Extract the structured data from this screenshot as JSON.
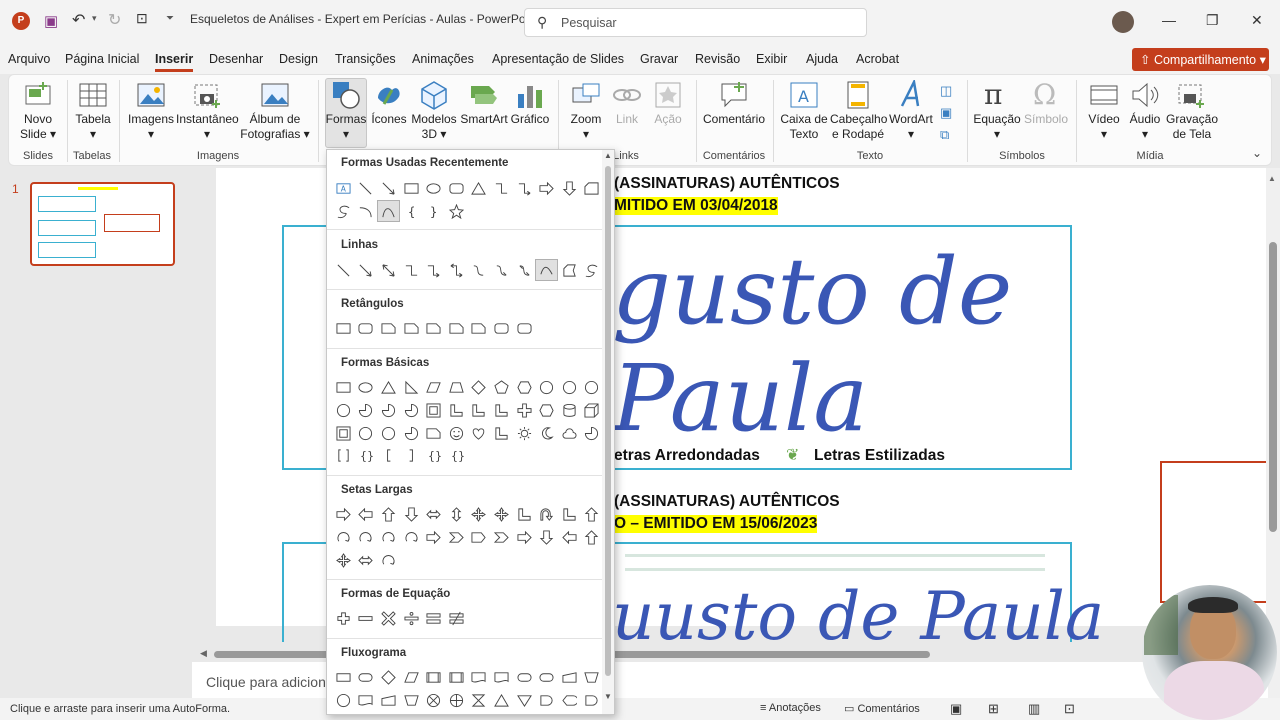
{
  "titlebar": {
    "doc_title": "Esqueletos de Análises - Expert em Perícias - Aulas  -  PowerPoint",
    "search_placeholder": "Pesquisar"
  },
  "menu": {
    "items": [
      "Arquivo",
      "Página Inicial",
      "Inserir",
      "Desenhar",
      "Design",
      "Transições",
      "Animações",
      "Apresentação de Slides",
      "Gravar",
      "Revisão",
      "Exibir",
      "Ajuda",
      "Acrobat"
    ],
    "active": "Inserir",
    "share_label": "Compartilhamento"
  },
  "ribbon": {
    "novo_slide": "Novo Slide",
    "tabela": "Tabela",
    "imagens": "Imagens",
    "instantaneo": "Instantâneo",
    "album": "Álbum de Fotografias",
    "formas": "Formas",
    "icones": "Ícones",
    "modelos3d": "Modelos 3D",
    "smartart": "SmartArt",
    "grafico": "Gráfico",
    "zoom": "Zoom",
    "link": "Link",
    "acao": "Ação",
    "comentario": "Comentário",
    "caixa_texto": "Caixa de Texto",
    "cabecalho": "Cabeçalho e Rodapé",
    "wordart": "WordArt",
    "equacao": "Equação",
    "simbolo": "Símbolo",
    "video": "Vídeo",
    "audio": "Áudio",
    "gravacao": "Gravação de Tela",
    "groups": {
      "slides": "Slides",
      "tabelas": "Tabelas",
      "imagens": "Imagens",
      "links": "Links",
      "comentarios": "Comentários",
      "texto": "Texto",
      "simbolos": "Símbolos",
      "midia": "Mídia"
    }
  },
  "shapes_menu": {
    "sections": {
      "recent": "Formas Usadas Recentemente",
      "linhas": "Linhas",
      "retangulos": "Retângulos",
      "basicas": "Formas Básicas",
      "setas": "Setas Largas",
      "equacao": "Formas de Equação",
      "fluxograma": "Fluxograma"
    }
  },
  "slide": {
    "number": "1",
    "line1": "(ASSINATURAS)  AUTÊNTICOS",
    "line2": "MITIDO EM 03/04/2018",
    "line3_a": "etras Arredondadas",
    "line3_b": "Letras Estilizadas",
    "line4": "(ASSINATURAS)  AUTÊNTICOS",
    "line5": "O – EMITIDO EM 15/06/2023",
    "sig1": "gusto de Paula",
    "sig2": "uusto de Paula"
  },
  "notes_placeholder": "Clique para adiciona",
  "status": {
    "hint": "Clique e arraste para inserir uma AutoForma.",
    "anotacoes": "Anotações",
    "comentarios": "Comentários"
  },
  "colors": {
    "accent": "#c43e1c",
    "highlight": "#ffff00",
    "frame": "#3ab0d0",
    "signature_ink": "#3a57b5"
  }
}
